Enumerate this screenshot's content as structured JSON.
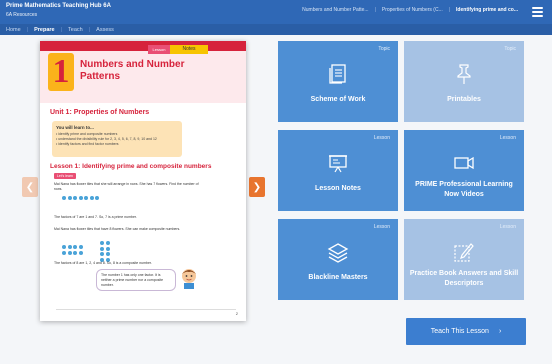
{
  "header": {
    "title": "Prime Mathematics Teaching Hub 6A",
    "subtitle": "6A Resources",
    "breadcrumbs": [
      "Numbers and Number Patte...",
      "Properties of Numbers (C...",
      "Identifying prime and co..."
    ]
  },
  "nav": {
    "items": [
      "Home",
      "Prepare",
      "Teach",
      "Assess"
    ],
    "active": "Prepare"
  },
  "book": {
    "chapter_number": "1",
    "chapter_title": "Numbers and Number Patterns",
    "unit_title": "Unit 1: Properties of Numbers",
    "learn_heading": "You will learn to...",
    "learn_points": [
      "• identify prime and composite numbers",
      "• understand the divisibility rule for 2, 3, 4, 5, 6, 7, 8, 9, 10 and 12",
      "• identify factors and find factor numbers"
    ],
    "lesson_title": "Lesson 1: Identifying prime and composite numbers",
    "lets_learn": "Let's learn",
    "q1": "Mai Nana has flower tiles that she will arrange in rows. She has 7 flowers. Find the number of rows.",
    "q1_note": "The factors of 7 are 1 and 7. So, 7 is a prime number.",
    "q2": "Mai Nana has flower tiles that have 8 flowers. She can make composite numbers.",
    "q2_note": "The factors of 8 are 1, 2, 4 and 8. So, 8 is a composite number.",
    "speech": "The number 1 has only one factor. It is neither a prime number nor a composite number.",
    "page_number": "2",
    "strip_pink": "Lesson",
    "strip_yellow": "Notes"
  },
  "tiles": [
    {
      "tag": "Topic",
      "label": "Scheme of Work",
      "icon": "document-icon"
    },
    {
      "tag": "Topic",
      "label": "Printables",
      "icon": "pin-icon"
    },
    {
      "tag": "Lesson",
      "label": "Lesson Notes",
      "icon": "presentation-icon"
    },
    {
      "tag": "Lesson",
      "label": "PRIME Professional Learning Now Videos",
      "icon": "video-icon"
    },
    {
      "tag": "Lesson",
      "label": "Blackline Masters",
      "icon": "layers-icon"
    },
    {
      "tag": "Lesson",
      "label": "Practice Book Answers and Skill Descriptors",
      "icon": "edit-icon"
    }
  ],
  "teach_button": {
    "label": "Teach This Lesson",
    "icon": "chevron-right-icon"
  },
  "colors": {
    "header": "#2f68b6",
    "tile_blue": "#4e8fd4",
    "tile_light": "#a6c2e4",
    "accent_orange": "#e8752f",
    "book_red": "#d6233c"
  }
}
